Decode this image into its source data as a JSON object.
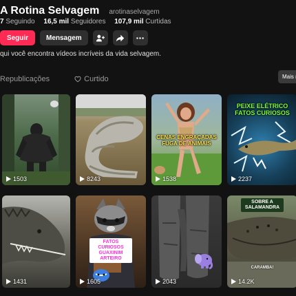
{
  "profile": {
    "title": "A Rotina Selvagem",
    "handle": "arotinaselvagem",
    "following_count": "7",
    "following_label": "Seguindo",
    "followers_count": "16,5 mil",
    "followers_label": "Seguidores",
    "likes_count": "107,9 mil",
    "likes_label": "Curtidas",
    "bio": "qui você encontra vídeos incríveis da vida selvagem."
  },
  "actions": {
    "follow_label": "Seguir",
    "message_label": "Mensagem",
    "add_friend_icon": "add-user-icon",
    "share_icon": "share-icon",
    "more_icon": "more-icon"
  },
  "tabs": [
    {
      "label": "Republicações",
      "icon": "repost-icon"
    },
    {
      "label": "Curtido",
      "icon": "heart-outline-icon"
    }
  ],
  "sort_button_label": "Mais re",
  "colors": {
    "accent": "#fe2c55",
    "background": "#121212"
  },
  "videos": [
    {
      "views": "1503",
      "caption": ""
    },
    {
      "views": "8243",
      "caption": ""
    },
    {
      "views": "1538",
      "caption": "CENAS ENGRAÇADAS\nFUGA DE ANIMAIS"
    },
    {
      "views": "2237",
      "caption": "PEIXE ELÉTRICO\nFATOS CURIOSOS"
    },
    {
      "views": "1431",
      "caption": ""
    },
    {
      "views": "1605",
      "caption": "FATOS CURIOSOS\nGUAXINIM\nARTEIRO"
    },
    {
      "views": "2043",
      "caption": ""
    },
    {
      "views": "14.2K",
      "caption": "SOBRE A\nSALAMANDRA",
      "subcaption": "CARAMBA!"
    }
  ]
}
